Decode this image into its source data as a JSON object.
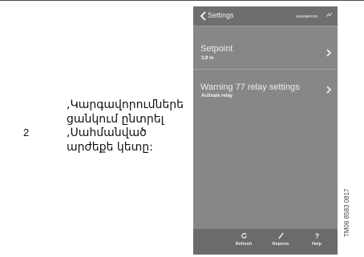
{
  "step": {
    "number": "2",
    "text": ",Կարգավորումներե\nցանկում ընտրել\n,Սահմանված\nարժեքե կետը:"
  },
  "phone": {
    "header": {
      "back_icon": "chevron-left-icon",
      "title": "Settings",
      "brand": "GRUNDFOS"
    },
    "rows": [
      {
        "label": "Setpoint",
        "value": "3,9 m",
        "icon": "chevron-right-icon"
      },
      {
        "label": "Warning 77 relay settings",
        "value": "Activate relay",
        "icon": "chevron-right-icon"
      }
    ],
    "toolbar": {
      "refresh": "Refresh",
      "reports": "Reports",
      "help": "Help"
    },
    "colors": {
      "screen": "#878787",
      "header": "#6e6e6e",
      "toolbar": "#6b6b6b",
      "text": "#ececec"
    }
  },
  "figure_code": "TM06 8583 0817"
}
